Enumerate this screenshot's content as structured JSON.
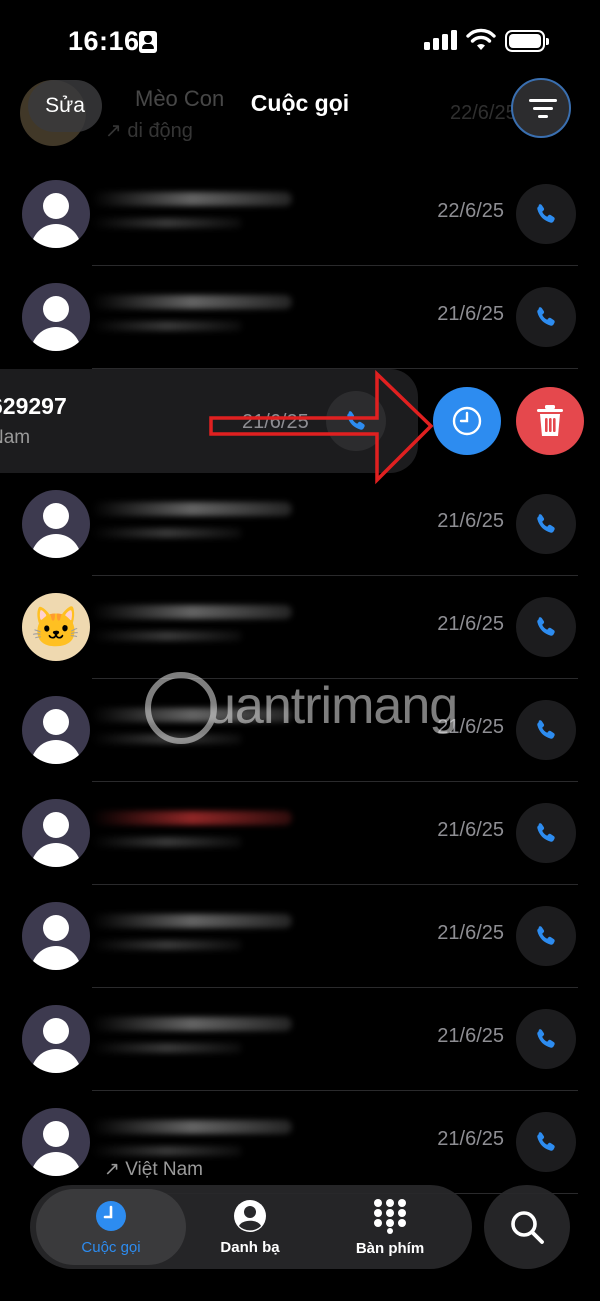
{
  "status_bar": {
    "time": "16:16"
  },
  "header": {
    "edit_label": "Sửa",
    "title": "Cuộc gọi",
    "ghost_name": "Mèo Con",
    "ghost_sub": "↗ di động",
    "ghost_date": "22/6/25"
  },
  "calls": [
    {
      "date": "22/6/25",
      "avatar": "person",
      "name_tint": "gray"
    },
    {
      "date": "21/6/25",
      "avatar": "person",
      "name_tint": "gray"
    },
    {
      "date": "21/6/25",
      "avatar": "person",
      "name_tint": "gray"
    },
    {
      "date": "21/6/25",
      "avatar": "cat",
      "name_tint": "gray"
    },
    {
      "date": "21/6/25",
      "avatar": "person",
      "name_tint": "gray"
    },
    {
      "date": "21/6/25",
      "avatar": "person",
      "name_tint": "red"
    },
    {
      "date": "21/6/25",
      "avatar": "person",
      "name_tint": "gray"
    },
    {
      "date": "21/6/25",
      "avatar": "person",
      "name_tint": "gray"
    },
    {
      "date": "21/6/25",
      "avatar": "person",
      "name_tint": "gray",
      "sub": "↗ Việt Nam"
    }
  ],
  "swiped_call": {
    "number": "629297",
    "location": "Nam",
    "date": "21/6/25"
  },
  "watermark": "uantrimang",
  "tabs": [
    {
      "label": "Cuộc gọi",
      "icon": "clock-icon",
      "active": true
    },
    {
      "label": "Danh bạ",
      "icon": "contact-icon",
      "active": false
    },
    {
      "label": "Bàn phím",
      "icon": "keypad-icon",
      "active": false
    }
  ],
  "colors": {
    "accent": "#2d8cf0",
    "delete": "#e5484d",
    "annotation_arrow": "#e02020"
  }
}
